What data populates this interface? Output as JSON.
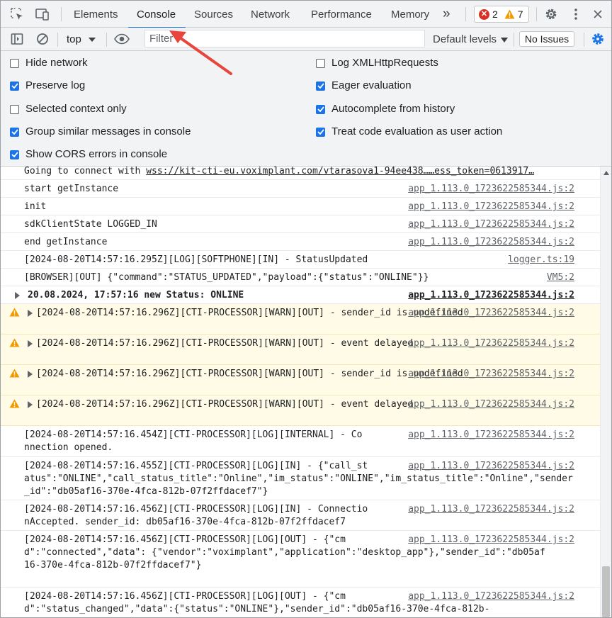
{
  "tabs": [
    {
      "label": "Elements"
    },
    {
      "label": "Console"
    },
    {
      "label": "Sources"
    },
    {
      "label": "Network"
    },
    {
      "label": "Performance"
    },
    {
      "label": "Memory"
    }
  ],
  "more_tabs": "»",
  "errors_count": "2",
  "warnings_count": "7",
  "toolbar": {
    "context": "top",
    "filter_placeholder": "Filter",
    "levels": "Default levels",
    "issues": "No Issues"
  },
  "settings_left": [
    {
      "label": "Hide network",
      "checked": false
    },
    {
      "label": "Preserve log",
      "checked": true
    },
    {
      "label": "Selected context only",
      "checked": false
    },
    {
      "label": "Group similar messages in console",
      "checked": true
    },
    {
      "label": "Show CORS errors in console",
      "checked": true
    }
  ],
  "settings_right": [
    {
      "label": "Log XMLHttpRequests",
      "checked": false
    },
    {
      "label": "Eager evaluation",
      "checked": true
    },
    {
      "label": "Autocomplete from history",
      "checked": true
    },
    {
      "label": "Treat code evaluation as user action",
      "checked": true
    }
  ],
  "console": {
    "first": {
      "prefix": "Going to connect with ",
      "link": "wss://kit-cti-eu.voximplant.com/vtarasova1-94ee438……ess_token=0613917…"
    },
    "messages": [
      {
        "text": "start getInstance",
        "source": "app_1.113.0_1723622585344.js:2"
      },
      {
        "text": "init",
        "source": "app_1.113.0_1723622585344.js:2"
      },
      {
        "text": "sdkClientState LOGGED_IN",
        "source": "app_1.113.0_1723622585344.js:2"
      },
      {
        "text": "end getInstance",
        "source": "app_1.113.0_1723622585344.js:2"
      },
      {
        "text": "[2024-08-20T14:57:16.295Z][LOG][SOFTPHONE][IN] - StatusUpdated",
        "source": "logger.ts:19"
      },
      {
        "text": "[BROWSER][OUT] {\"command\":\"STATUS_UPDATED\",\"payload\":{\"status\":\"ONLINE\"}}",
        "source": "VM5:2"
      },
      {
        "text": "20.08.2024, 17:57:16 new Status: ONLINE",
        "source": "app_1.113.0_1723622585344.js:2"
      },
      {
        "text": "[2024-08-20T14:57:16.296Z][CTI-PROCESSOR][WARN][OUT] - sender_id is undefined",
        "source": "app_1.113.0_1723622585344.js:2"
      },
      {
        "text": "[2024-08-20T14:57:16.296Z][CTI-PROCESSOR][WARN][OUT] - event delayed",
        "source": "app_1.113.0_1723622585344.js:2"
      },
      {
        "text": "[2024-08-20T14:57:16.296Z][CTI-PROCESSOR][WARN][OUT] - sender_id is undefined",
        "source": "app_1.113.0_1723622585344.js:2"
      },
      {
        "text": "[2024-08-20T14:57:16.296Z][CTI-PROCESSOR][WARN][OUT] - event delayed",
        "source": "app_1.113.0_1723622585344.js:2"
      },
      {
        "text": "[2024-08-20T14:57:16.454Z][CTI-PROCESSOR][LOG][INTERNAL] - Connection opened.",
        "source": "app_1.113.0_1723622585344.js:2"
      },
      {
        "text": "[2024-08-20T14:57:16.455Z][CTI-PROCESSOR][LOG][IN] - {\"call_status\":\"ONLINE\",\"call_status_title\":\"Online\",\"im_status\":\"ONLINE\",\"im_status_title\":\"Online\",\"sender_id\":\"db05af16-370e-4fca-812b-07f2ffdacef7\"}",
        "source": "app_1.113.0_1723622585344.js:2"
      },
      {
        "text": "[2024-08-20T14:57:16.456Z][CTI-PROCESSOR][LOG][IN] - ConnectionAccepted. sender_id: db05af16-370e-4fca-812b-07f2ffdacef7",
        "source": "app_1.113.0_1723622585344.js:2"
      },
      {
        "text": "[2024-08-20T14:57:16.456Z][CTI-PROCESSOR][LOG][OUT] - {\"cmd\":\"connected\",\"data\": {\"vendor\":\"voximplant\",\"application\":\"desktop_app\"},\"sender_id\":\"db05af16-370e-4fca-812b-07f2ffdacef7\"}",
        "source": "app_1.113.0_1723622585344.js:2"
      },
      {
        "text": "[2024-08-20T14:57:16.456Z][CTI-PROCESSOR][LOG][OUT] - {\"cmd\":\"status_changed\",\"data\":{\"status\":\"ONLINE\"},\"sender_id\":\"db05af16-370e-4fca-812b-",
        "source": "app_1.113.0_1723622585344.js:2"
      }
    ]
  },
  "colors": {
    "accent": "#1a73e8",
    "warning_bg": "#fffbe6",
    "warning_icon": "#f29900",
    "error": "#d93025",
    "arrow": "#e8453c"
  }
}
